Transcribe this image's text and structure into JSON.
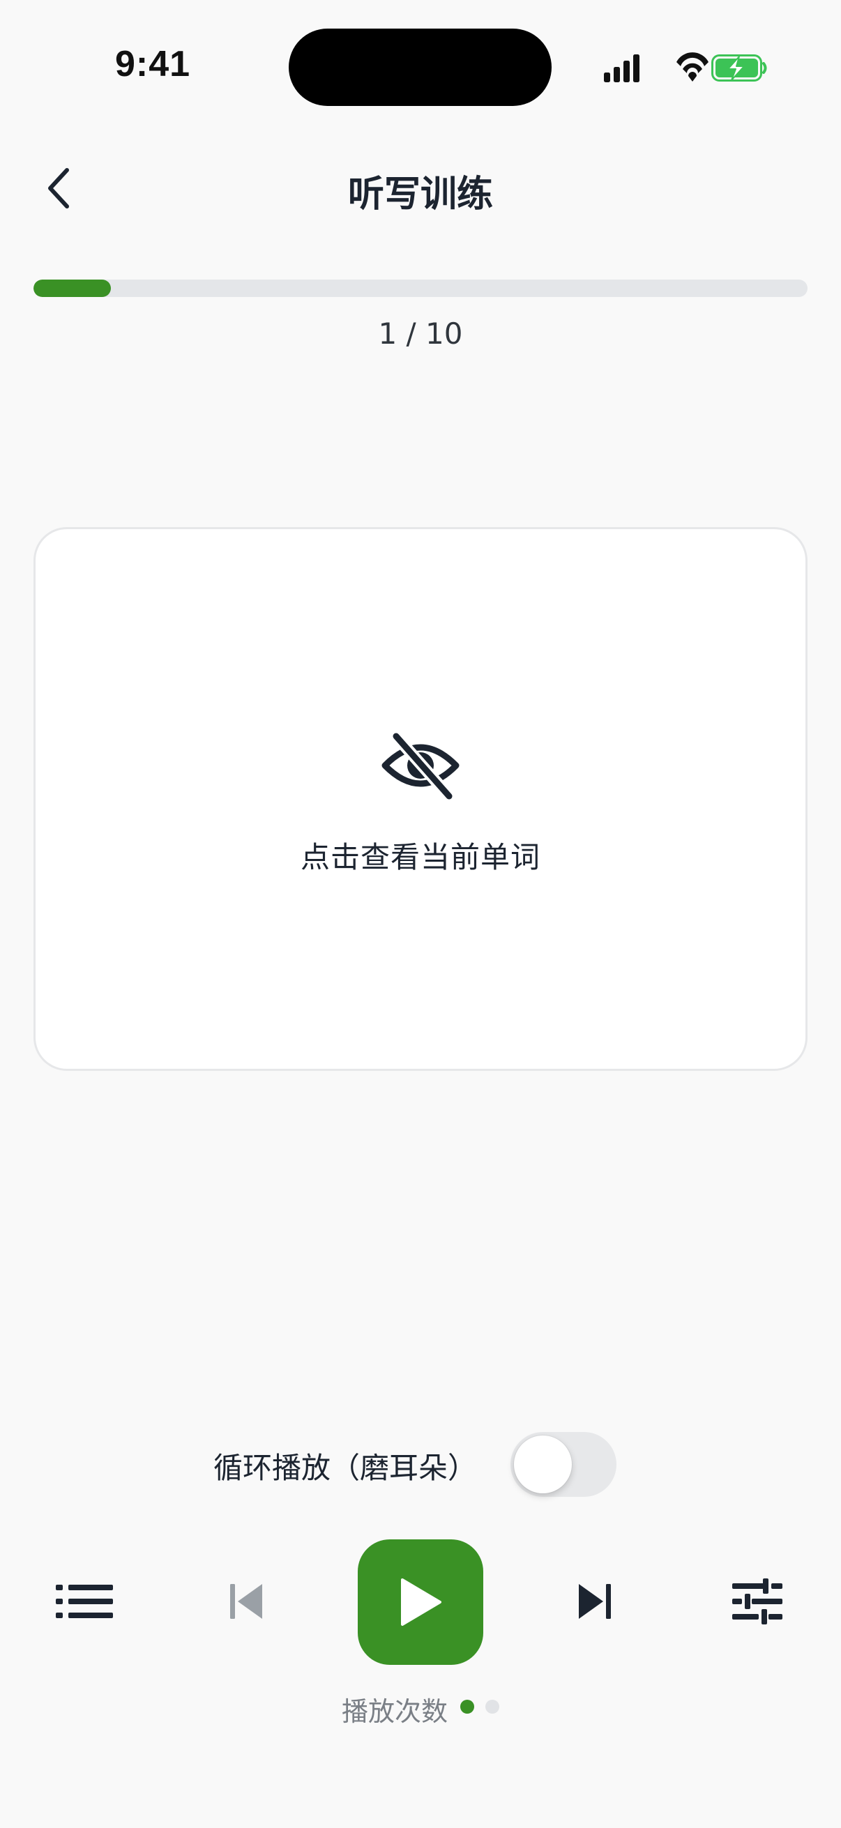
{
  "status_bar": {
    "time": "9:41",
    "icons": [
      "cellular-signal-icon",
      "wifi-icon",
      "battery-charging-icon"
    ]
  },
  "header": {
    "title": "听写训练",
    "back_icon": "chevron-left-icon"
  },
  "progress": {
    "current": 1,
    "total": 10,
    "label": "1 / 10",
    "fraction": 0.1
  },
  "card": {
    "icon": "eye-off-icon",
    "hint": "点击查看当前单词"
  },
  "loop": {
    "label": "循环播放（磨耳朵）",
    "enabled": false
  },
  "controls": {
    "list_icon": "list-icon",
    "prev_icon": "skip-previous-icon",
    "play_icon": "play-icon",
    "next_icon": "skip-next-icon",
    "settings_icon": "sliders-icon"
  },
  "play_count": {
    "label": "播放次数",
    "filled": 1,
    "total": 2
  },
  "colors": {
    "accent": "#3a9125",
    "background": "#f9f9f9",
    "text": "#1c2430",
    "muted": "#7a7f86",
    "disabled_icon": "#9aa0a6",
    "track": "#e4e6e9",
    "battery": "#3cc356"
  }
}
